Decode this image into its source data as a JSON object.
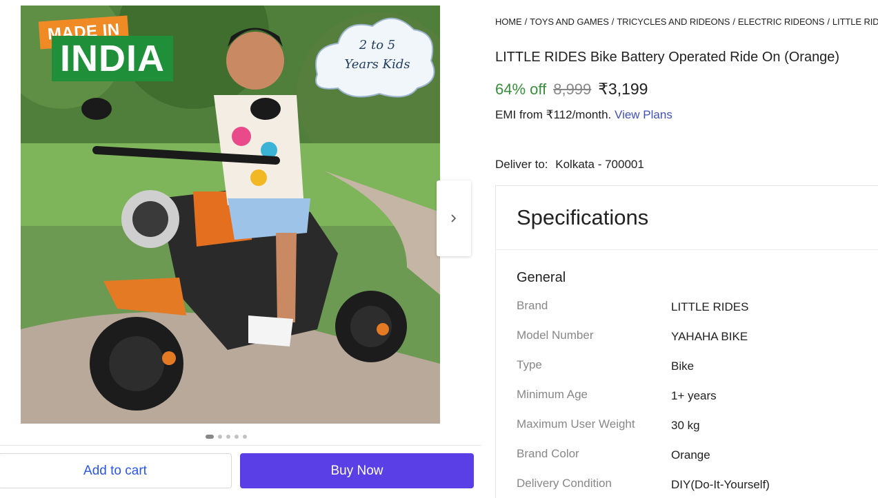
{
  "image": {
    "badge_top": "MADE IN",
    "badge_bottom": "INDIA",
    "cloud_line1": "2 to 5",
    "cloud_line2": "Years Kids"
  },
  "carousel": {
    "dots": 5,
    "active_index": 0,
    "next_icon": "chevron-right-icon"
  },
  "actions": {
    "add_to_cart": "Add to cart",
    "buy_now": "Buy Now"
  },
  "breadcrumb": [
    "HOME",
    "TOYS AND GAMES",
    "TRICYCLES AND RIDEONS",
    "ELECTRIC RIDEONS",
    "LITTLE RIDES"
  ],
  "product": {
    "title": "LITTLE RIDES Bike Battery Operated Ride On (Orange)",
    "discount": "64% off",
    "mrp": "8,999",
    "price": "₹3,199",
    "emi_text": "EMI from ₹112/month.",
    "emi_link": "View Plans"
  },
  "delivery": {
    "label": "Deliver to:",
    "location": "Kolkata - 700001"
  },
  "specifications": {
    "title": "Specifications",
    "group": "General",
    "rows": [
      {
        "key": "Brand",
        "value": "LITTLE RIDES"
      },
      {
        "key": "Model Number",
        "value": "YAHAHA BIKE"
      },
      {
        "key": "Type",
        "value": "Bike"
      },
      {
        "key": "Minimum Age",
        "value": "1+ years"
      },
      {
        "key": "Maximum User Weight",
        "value": "30 kg"
      },
      {
        "key": "Brand Color",
        "value": "Orange"
      },
      {
        "key": "Delivery Condition",
        "value": "DIY(Do-It-Yourself)"
      }
    ]
  },
  "colors": {
    "accent": "#5a3fe6",
    "link": "#3f51b5",
    "discount": "#388e3c",
    "muted": "#878787"
  }
}
